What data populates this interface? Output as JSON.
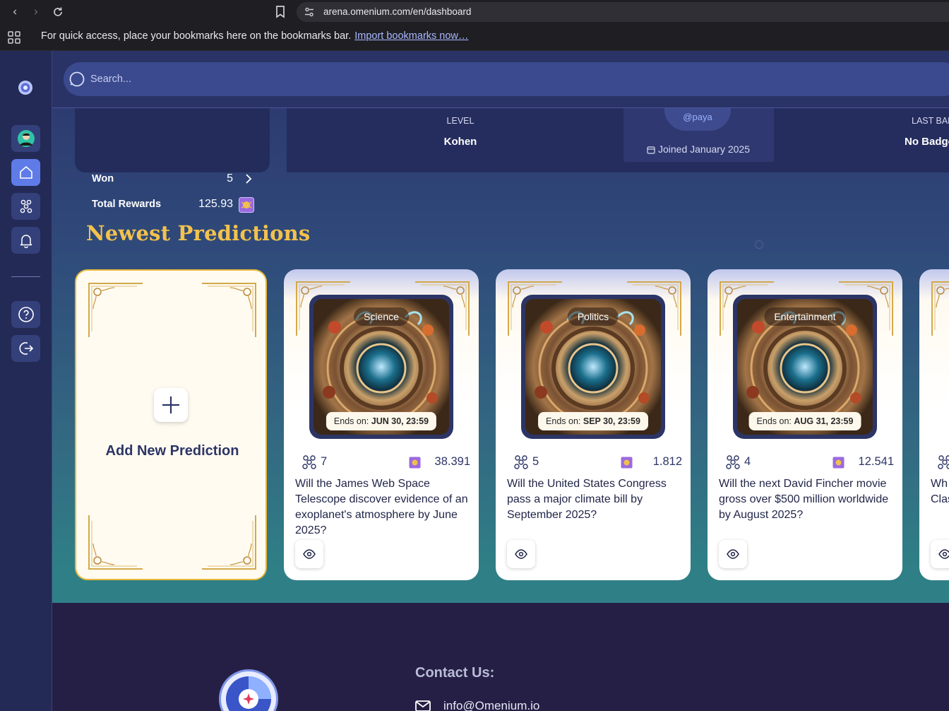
{
  "browser": {
    "url": "arena.omenium.com/en/dashboard",
    "bookmarks_message": "For quick access, place your bookmarks here on the bookmarks bar.",
    "bookmarks_link": "Import bookmarks now…"
  },
  "search": {
    "placeholder": "Search..."
  },
  "stats": {
    "rows": [
      {
        "label": "Won",
        "value": "5"
      },
      {
        "label": "Total Rewards",
        "value": "125.93"
      }
    ]
  },
  "profile": {
    "level_label": "LEVEL",
    "level_value": "Kohen",
    "handle": "@paya",
    "joined": "Joined January 2025",
    "last_badge_label": "LAST BAD",
    "last_badge_value": "No Badge"
  },
  "section": {
    "title": "Newest Predictions"
  },
  "add_card": {
    "label": "Add New Prediction"
  },
  "ends_prefix": "Ends on:",
  "predictions": [
    {
      "category": "Science",
      "ends": "JUN 30, 23:59",
      "participants": "7",
      "pool": "38.391",
      "question": "Will the James Web Space Telescope discover evidence of an exoplanet's atmosphere by June 2025?"
    },
    {
      "category": "Politics",
      "ends": "SEP 30, 23:59",
      "participants": "5",
      "pool": "1.812",
      "question": "Will the United States Congress pass a major climate bill by September 2025?"
    },
    {
      "category": "Entertainment",
      "ends": "AUG 31, 23:59",
      "participants": "4",
      "pool": "12.541",
      "question": "Will the next David Fincher movie gross over $500 million worldwide by August 2025?"
    },
    {
      "question": "Wh\nClas"
    }
  ],
  "footer": {
    "contact_title": "Contact Us:",
    "email": "info@Omenium.io"
  },
  "colors": {
    "accent_gold": "#f3c24d",
    "sidebar": "#232a55",
    "active": "#5f7be8"
  }
}
